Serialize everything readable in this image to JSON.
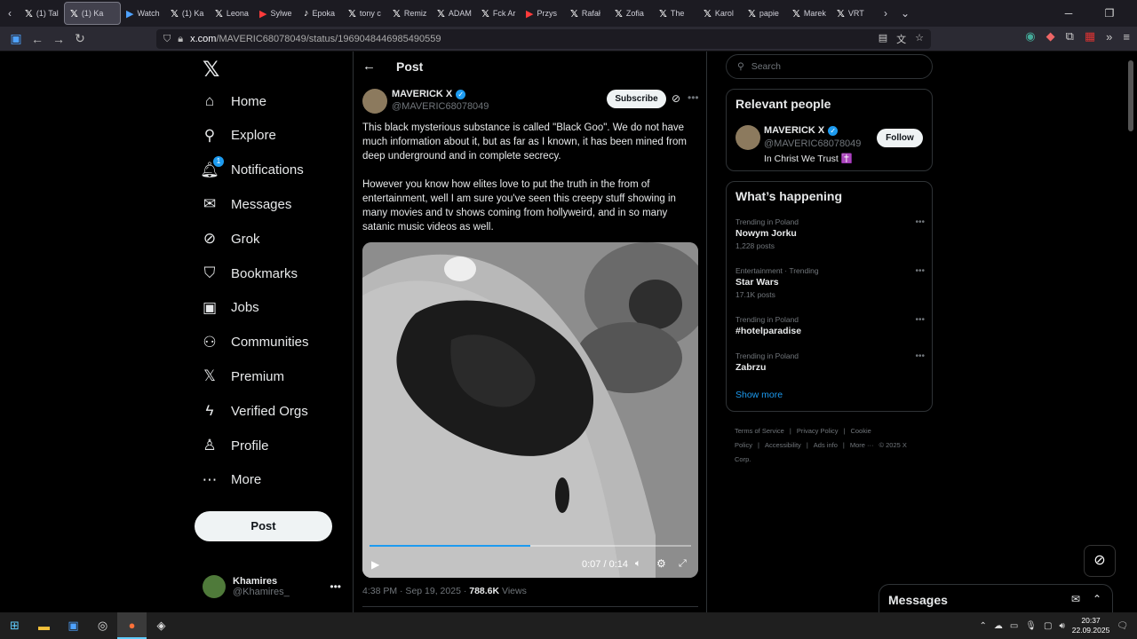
{
  "browser": {
    "tabs": [
      {
        "title": "(1) Tal",
        "icon": "x-logo"
      },
      {
        "title": "(1) Ka",
        "icon": "x-logo",
        "active": true
      },
      {
        "title": "Watch",
        "icon": "film"
      },
      {
        "title": "(1) Ka",
        "icon": "x-logo"
      },
      {
        "title": "Leona",
        "icon": "x-logo"
      },
      {
        "title": "Sylwe",
        "icon": "youtube"
      },
      {
        "title": "Epoka",
        "icon": "tiktok"
      },
      {
        "title": "tony c",
        "icon": "x-logo"
      },
      {
        "title": "Remiz",
        "icon": "x-logo"
      },
      {
        "title": "ADAM",
        "icon": "x-logo"
      },
      {
        "title": "Fck Ar",
        "icon": "x-logo"
      },
      {
        "title": "Przys",
        "icon": "youtube"
      },
      {
        "title": "Rafał",
        "icon": "x-logo"
      },
      {
        "title": "Zofia",
        "icon": "x-logo"
      },
      {
        "title": "The",
        "icon": "x-logo"
      },
      {
        "title": "Karol",
        "icon": "x-logo"
      },
      {
        "title": "papie",
        "icon": "x-logo"
      },
      {
        "title": "Marek",
        "icon": "x-logo"
      },
      {
        "title": "VRT",
        "icon": "x-logo"
      }
    ],
    "url_host": "x.com",
    "url_path": "/MAVERIC68078049/status/1969048446985490559"
  },
  "nav": {
    "items": [
      {
        "label": "Home",
        "icon": "home-icon"
      },
      {
        "label": "Explore",
        "icon": "search-icon"
      },
      {
        "label": "Notifications",
        "icon": "bell-icon",
        "badge": "1"
      },
      {
        "label": "Messages",
        "icon": "mail-icon"
      },
      {
        "label": "Grok",
        "icon": "grok-icon"
      },
      {
        "label": "Bookmarks",
        "icon": "bookmark-icon"
      },
      {
        "label": "Jobs",
        "icon": "briefcase-icon"
      },
      {
        "label": "Communities",
        "icon": "people-icon"
      },
      {
        "label": "Premium",
        "icon": "x-logo-icon"
      },
      {
        "label": "Verified Orgs",
        "icon": "lightning-icon"
      },
      {
        "label": "Profile",
        "icon": "person-icon"
      },
      {
        "label": "More",
        "icon": "more-circle-icon"
      }
    ],
    "post_button": "Post",
    "account": {
      "name": "Khamires",
      "handle": "@Khamires_"
    }
  },
  "post": {
    "header_title": "Post",
    "author_name": "MAVERICK X",
    "author_handle": "@MAVERIC68078049",
    "subscribe_label": "Subscribe",
    "paragraph1": "This black mysterious substance is called \"Black Goo\". We do not have much information about it, but as far as I known, it has been mined from deep underground and in complete secrecy.",
    "paragraph2": "However you know how elites love to put the truth in the from of entertainment, well I am sure you've seen this creepy stuff showing in many movies and tv shows coming from hollyweird, and in so many satanic music videos as well.",
    "video": {
      "current": "0:07",
      "duration": "0:14",
      "progress": 0.5
    },
    "timestamp": "4:38 PM · Sep 19, 2025 · ",
    "views_count": "788.6K",
    "views_label": " Views"
  },
  "sidebar": {
    "search_placeholder": "Search",
    "relevant_title": "Relevant people",
    "relevant_person": {
      "name": "MAVERICK X",
      "handle": "@MAVERIC68078049",
      "bio": "In Christ We Trust ✝️",
      "follow_label": "Follow"
    },
    "happening_title": "What’s happening",
    "trends": [
      {
        "context": "Trending in Poland",
        "name": "Nowym Jorku",
        "count": "1,228 posts"
      },
      {
        "context": "Entertainment · Trending",
        "name": "Star Wars",
        "count": "17.1K posts"
      },
      {
        "context": "Trending in Poland",
        "name": "#hotelparadise",
        "count": ""
      },
      {
        "context": "Trending in Poland",
        "name": "Zabrzu",
        "count": ""
      }
    ],
    "show_more": "Show more",
    "footer": [
      "Terms of Service",
      "|",
      "Privacy Policy",
      "|",
      "Cookie Policy",
      "|",
      "Accessibility",
      "|",
      "Ads info",
      "|",
      "More ···",
      "© 2025 X Corp."
    ]
  },
  "messages_drawer": {
    "title": "Messages"
  },
  "taskbar": {
    "time": "20:37",
    "date": "22.09.2025"
  }
}
